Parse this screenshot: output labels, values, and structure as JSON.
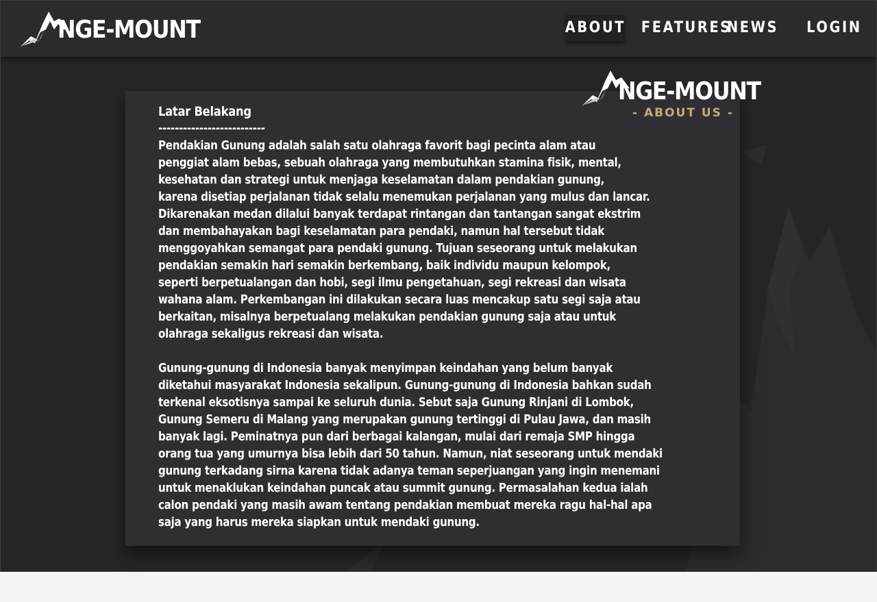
{
  "brand": {
    "name": "NGE-MOUNT",
    "icon": "mountain-peaks-icon"
  },
  "nav": {
    "items": [
      {
        "label": "ABOUT",
        "active": true
      },
      {
        "label": "FEATURES",
        "active": false
      },
      {
        "label": "NEWS",
        "active": false
      }
    ],
    "login_label": "LOGIN"
  },
  "about": {
    "logo_name": "NGE-MOUNT",
    "logo_subtitle": "- ABOUT US -",
    "heading": "Latar Belakang",
    "divider": "--------------------------",
    "paragraph1_lines": [
      "Pendakian Gunung adalah salah satu olahraga favorit bagi pecinta alam atau",
      "penggiat alam bebas, sebuah olahraga yang membutuhkan stamina fisik, mental,",
      "kesehatan dan strategi untuk menjaga keselamatan dalam pendakian gunung,",
      "karena disetiap perjalanan tidak selalu menemukan perjalanan yang mulus dan lancar.",
      " Dikarenakan medan dilalui banyak terdapat rintangan dan tantangan sangat ekstrim",
      "dan membahayakan bagi keselamatan para pendaki, namun hal tersebut tidak",
      "menggoyahkan semangat para pendaki gunung. Tujuan seseorang untuk melakukan",
      "pendakian semakin hari semakin berkembang, baik individu maupun kelompok,",
      "seperti berpetualangan dan hobi, segi ilmu pengetahuan, segi rekreasi dan wisata",
      "wahana alam. Perkembangan ini dilakukan secara luas mencakup satu segi saja atau",
      "berkaitan, misalnya berpetualang melakukan pendakian gunung saja atau untuk",
      "olahraga sekaligus rekreasi dan wisata."
    ],
    "paragraph2_lines": [
      "Gunung-gunung di Indonesia banyak menyimpan keindahan yang belum banyak",
      "diketahui masyarakat Indonesia sekalipun. Gunung-gunung di Indonesia bahkan sudah",
      "terkenal eksotisnya sampai ke seluruh dunia. Sebut saja Gunung Rinjani di Lombok,",
      "Gunung Semeru di Malang yang merupakan gunung tertinggi di Pulau Jawa, dan masih",
      "banyak lagi. Peminatnya pun dari berbagai kalangan, mulai dari remaja SMP hingga",
      "orang tua yang umurnya bisa lebih dari 50 tahun. Namun, niat seseorang untuk mendaki",
      "gunung terkadang sirna karena tidak adanya teman seperjuangan yang ingin menemani",
      "untuk menaklukan keindahan puncak atau summit gunung. Permasalahan kedua ialah",
      "calon pendaki yang masih awam tentang pendakian membuat mereka ragu hal-hal apa",
      "saja yang harus mereka siapkan untuk mendaki gunung."
    ]
  },
  "colors": {
    "background": "#262629",
    "navbar": "#2b2b2e",
    "card": "#2f2e33",
    "text": "#ffffff",
    "accent": "#c9a97a"
  }
}
